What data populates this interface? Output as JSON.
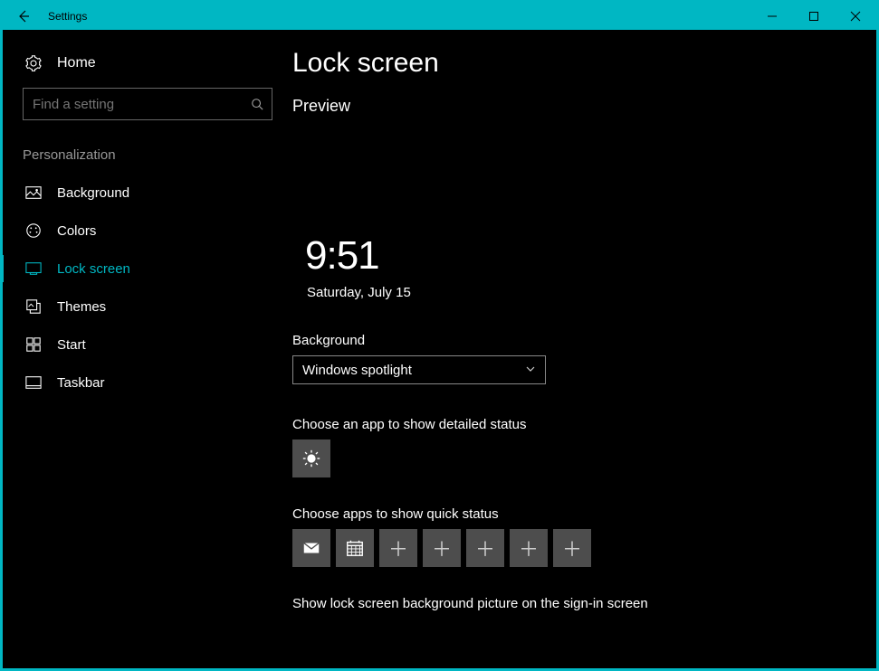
{
  "window": {
    "title": "Settings"
  },
  "sidebar": {
    "home_label": "Home",
    "search_placeholder": "Find a setting",
    "group_title": "Personalization",
    "items": [
      {
        "label": "Background"
      },
      {
        "label": "Colors"
      },
      {
        "label": "Lock screen",
        "selected": true
      },
      {
        "label": "Themes"
      },
      {
        "label": "Start"
      },
      {
        "label": "Taskbar"
      }
    ]
  },
  "main": {
    "page_title": "Lock screen",
    "preview_label": "Preview",
    "preview_time": "9:51",
    "preview_date": "Saturday, July 15",
    "background_label": "Background",
    "background_selected": "Windows spotlight",
    "detailed_status_label": "Choose an app to show detailed status",
    "quick_status_label": "Choose apps to show quick status",
    "sign_in_label": "Show lock screen background picture on the sign-in screen"
  }
}
